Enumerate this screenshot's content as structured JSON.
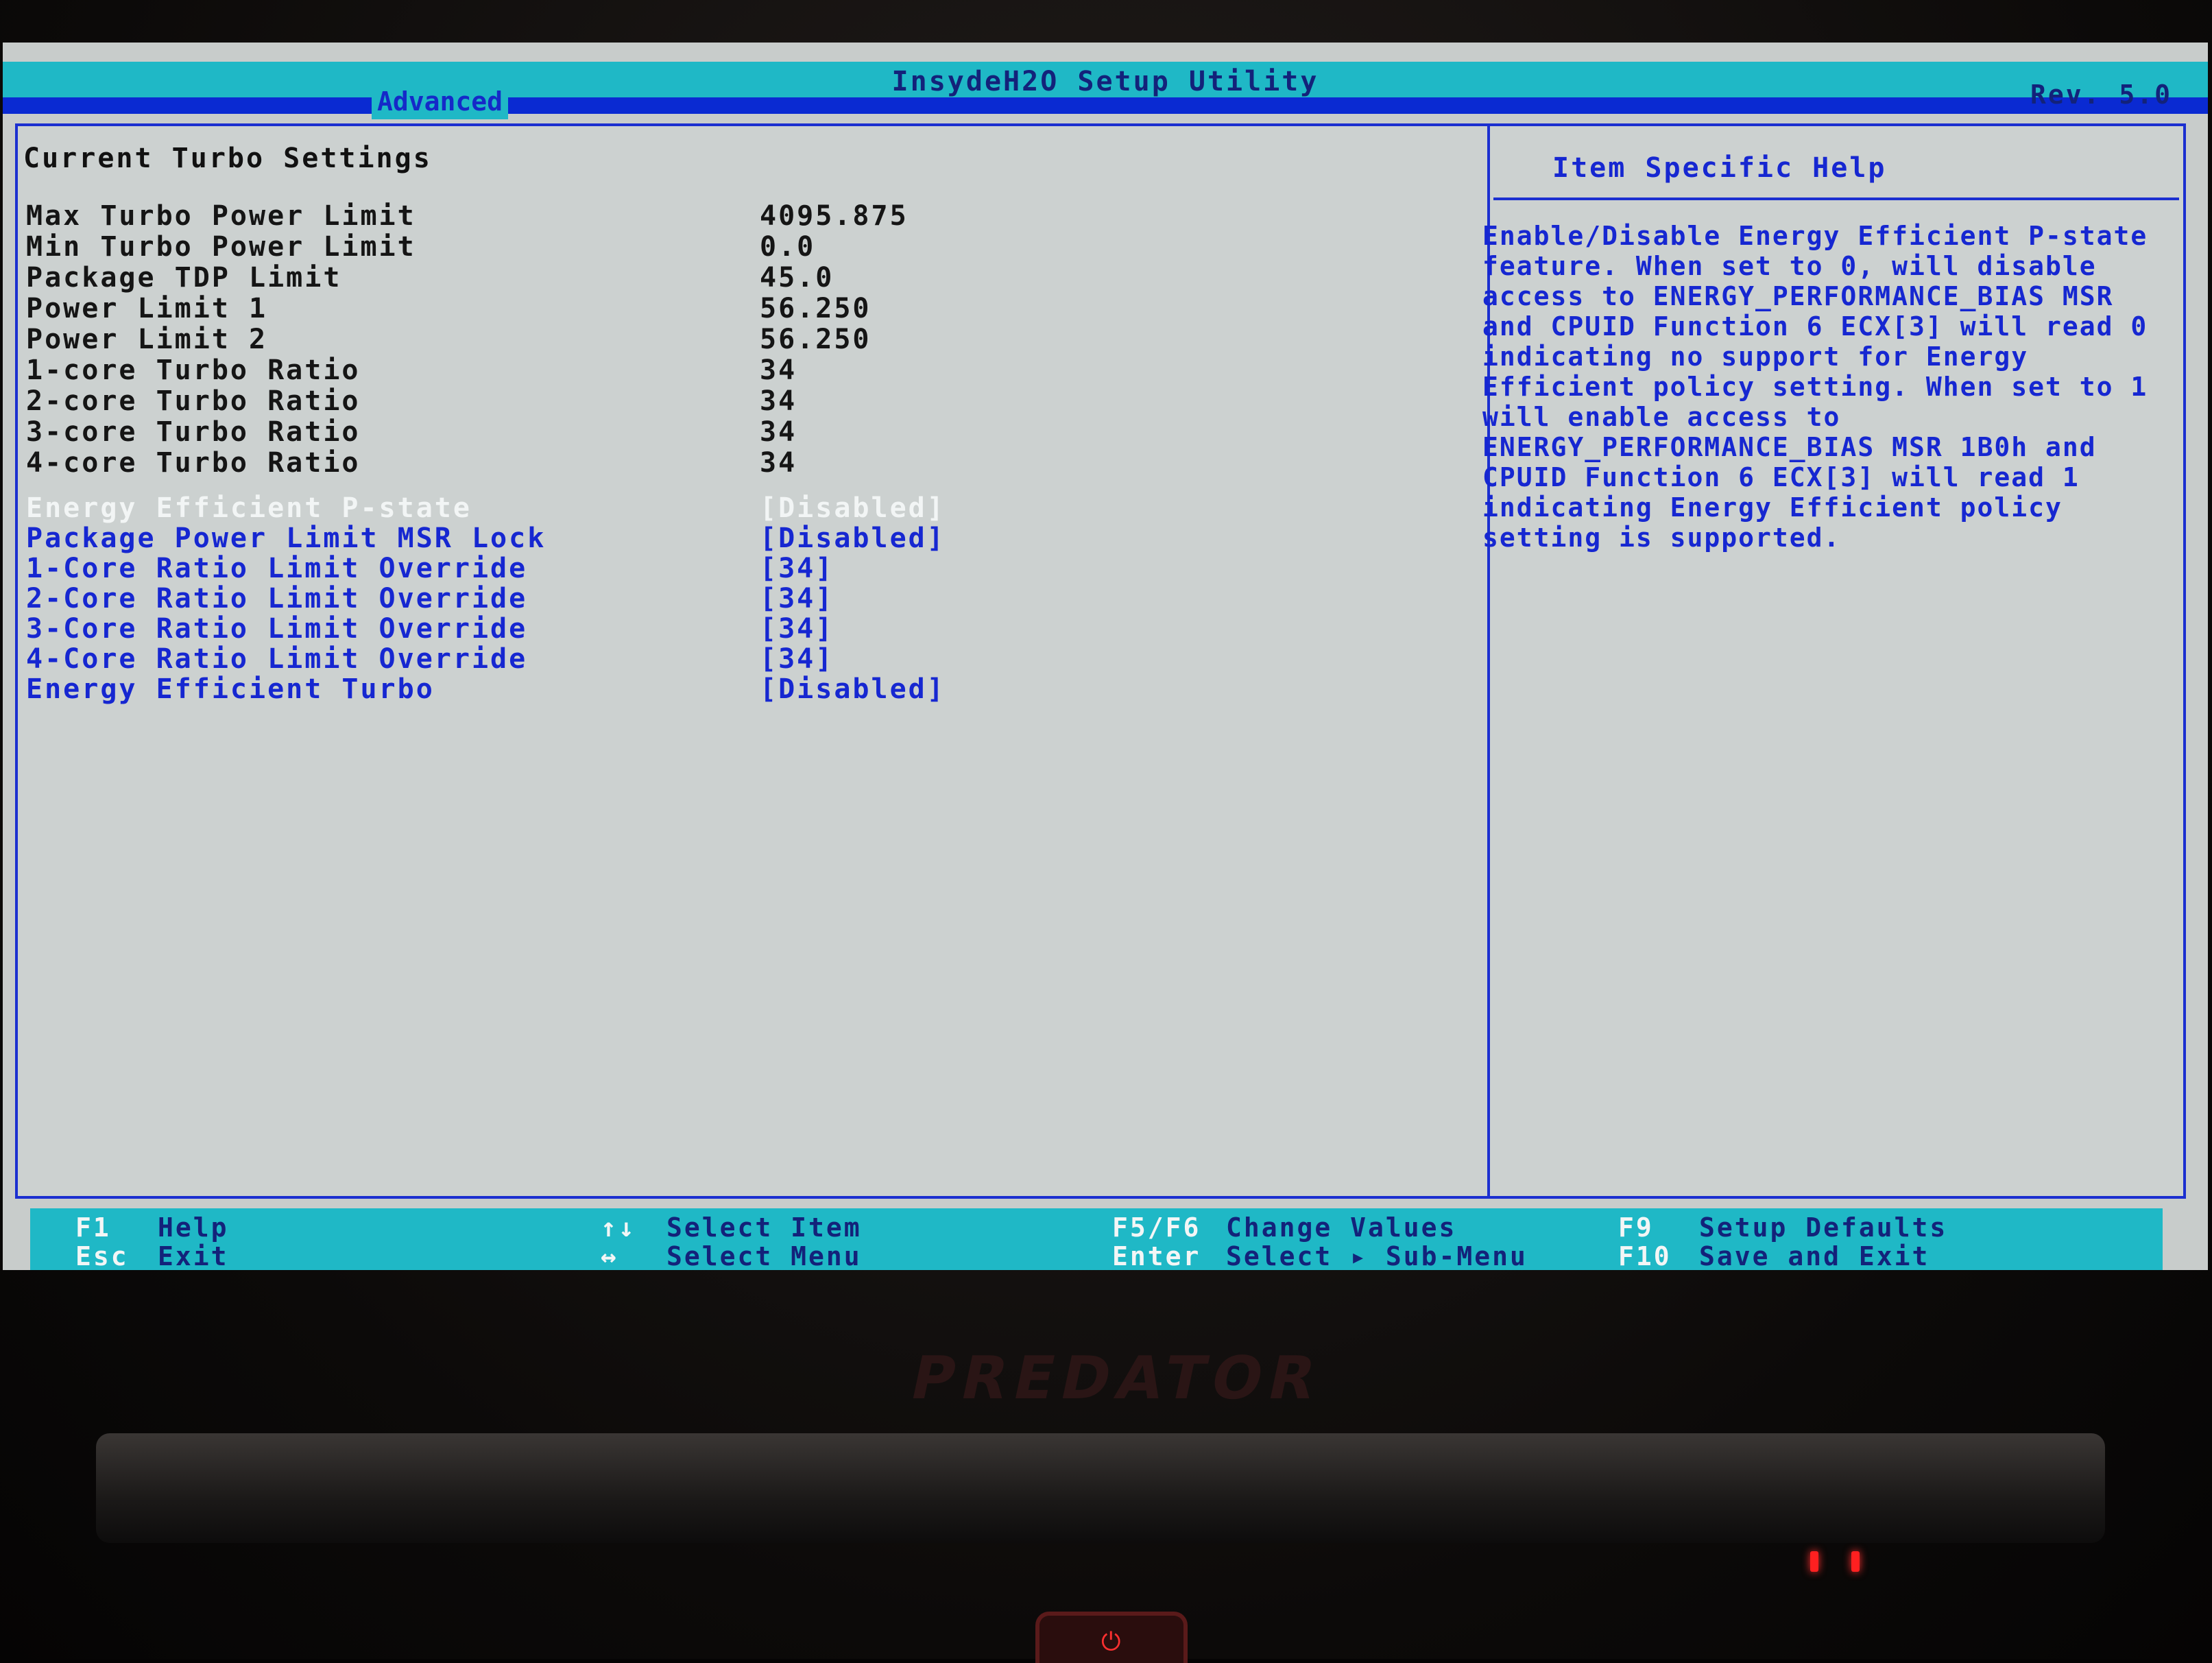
{
  "window": {
    "title": "InsydeH2O Setup Utility",
    "revision": "Rev. 5.0",
    "active_tab": "Advanced"
  },
  "section": {
    "title": "Current Turbo Settings"
  },
  "info_rows": [
    {
      "label": "Max Turbo Power Limit",
      "value": "4095.875"
    },
    {
      "label": "Min Turbo Power Limit",
      "value": "0.0"
    },
    {
      "label": "Package TDP Limit",
      "value": "45.0"
    },
    {
      "label": "Power Limit 1",
      "value": "56.250"
    },
    {
      "label": "Power Limit 2",
      "value": "56.250"
    },
    {
      "label": "1-core Turbo Ratio",
      "value": "34"
    },
    {
      "label": "2-core Turbo Ratio",
      "value": "34"
    },
    {
      "label": "3-core Turbo Ratio",
      "value": "34"
    },
    {
      "label": "4-core Turbo Ratio",
      "value": "34"
    }
  ],
  "options": [
    {
      "label": "Energy Efficient P-state",
      "value": "[Disabled]",
      "selected": true
    },
    {
      "label": "Package Power Limit MSR Lock",
      "value": "[Disabled]"
    },
    {
      "label": "1-Core Ratio Limit Override",
      "value": "[34]"
    },
    {
      "label": "2-Core Ratio Limit Override",
      "value": "[34]"
    },
    {
      "label": "3-Core Ratio Limit Override",
      "value": "[34]"
    },
    {
      "label": "4-Core Ratio Limit Override",
      "value": "[34]"
    },
    {
      "label": "Energy Efficient Turbo",
      "value": "[Disabled]"
    }
  ],
  "help": {
    "title": "Item Specific Help",
    "text": "Enable/Disable Energy Efficient P-state feature. When set to 0, will disable access to ENERGY_PERFORMANCE_BIAS MSR and CPUID Function 6 ECX[3] will read 0 indicating no support for Energy Efficient policy setting. When set to 1 will enable access to ENERGY_PERFORMANCE_BIAS MSR 1B0h and CPUID Function 6 ECX[3] will read 1 indicating Energy Efficient policy setting is supported."
  },
  "footer": {
    "f1_key": "F1",
    "f1_desc": "Help",
    "esc_key": "Esc",
    "esc_desc": "Exit",
    "updown_key": "↑↓",
    "updown_desc": "Select Item",
    "leftright_key": "↔",
    "leftright_desc": "Select Menu",
    "f5f6_key": "F5/F6",
    "f5f6_desc": "Change Values",
    "enter_key": "Enter",
    "enter_desc": "Select ▸ Sub-Menu",
    "f9_key": "F9",
    "f9_desc": "Setup Defaults",
    "f10_key": "F10",
    "f10_desc": "Save and Exit"
  },
  "hardware": {
    "brand": "PREDATOR"
  }
}
